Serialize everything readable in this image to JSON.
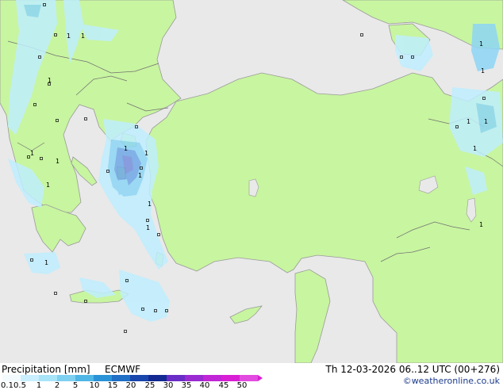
{
  "map": {
    "colors": {
      "sea": "#e9e9e9",
      "land": "#c8f5a0",
      "coast": "#9a9a9a",
      "border": "#707070",
      "precip_light": "#bfeeff",
      "precip_med": "#8ed6f5",
      "precip_heavy": "#6fa8e6",
      "precip_core": "#7890dc"
    },
    "labels": [
      "1",
      "1",
      "1",
      "1",
      "1",
      "1",
      "1",
      "1",
      "1",
      "1",
      "1",
      "1",
      "1",
      "1",
      "1",
      "1",
      "1",
      "1"
    ]
  },
  "footer": {
    "title": "Precipitation [mm]",
    "model": "ECMWF",
    "datetime": "Th 12-03-2026 06..12 UTC (00+276)",
    "credit": "©weatheronline.co.uk"
  },
  "legend": {
    "ticks": [
      "0.1",
      "0.5",
      "1",
      "2",
      "5",
      "10",
      "15",
      "20",
      "25",
      "30",
      "35",
      "40",
      "45",
      "50"
    ],
    "colors": [
      "#f3fbff",
      "#c9efff",
      "#a8e4f8",
      "#7fd0f0",
      "#4fb6e6",
      "#2a93d8",
      "#1f6fc6",
      "#1946ad",
      "#122a92",
      "#6a2cc7",
      "#9a2ad2",
      "#c126d6",
      "#d91fd6",
      "#e34be0"
    ]
  }
}
